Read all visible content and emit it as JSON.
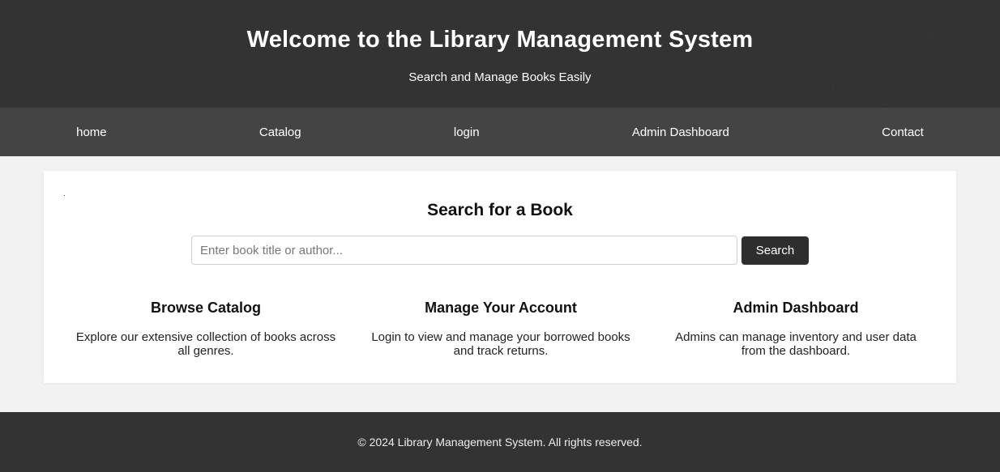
{
  "header": {
    "title": "Welcome to the Library Management System",
    "subtitle": "Search and Manage Books Easily"
  },
  "nav": {
    "items": [
      {
        "label": "home"
      },
      {
        "label": "Catalog"
      },
      {
        "label": "login"
      },
      {
        "label": "Admin Dashboard"
      },
      {
        "label": "Contact"
      }
    ]
  },
  "search": {
    "heading": "Search for a Book",
    "placeholder": "Enter book title or author...",
    "value": "",
    "button_label": "Search"
  },
  "features": [
    {
      "title": "Browse Catalog",
      "text": "Explore our extensive collection of books across all genres."
    },
    {
      "title": "Manage Your Account",
      "text": "Login to view and manage your borrowed books and track returns."
    },
    {
      "title": "Admin Dashboard",
      "text": "Admins can manage inventory and user data from the dashboard."
    }
  ],
  "footer": {
    "text": "© 2024 Library Management System. All rights reserved."
  },
  "colors": {
    "header_bg": "#333333",
    "nav_bg": "#444444",
    "page_bg": "#f2f2f2",
    "button_bg": "#2e2e2e"
  }
}
